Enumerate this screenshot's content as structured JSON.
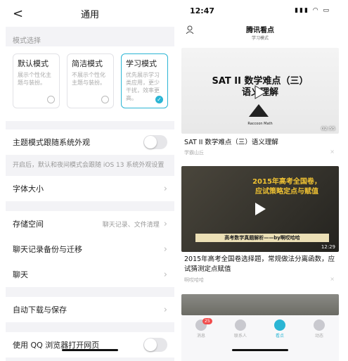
{
  "left": {
    "title": "通用",
    "back": "<",
    "section_label": "模式选择",
    "modes": [
      {
        "name": "默认模式",
        "desc": "展示个性化主题与装扮。",
        "selected": false
      },
      {
        "name": "简洁模式",
        "desc": "不展示个性化主题与装扮。",
        "selected": false
      },
      {
        "name": "学习模式",
        "desc": "优先展示学习类应用，更少干扰，效率更高。",
        "selected": true
      }
    ],
    "theme_follow": {
      "label": "主题模式跟随系统外观",
      "on": false
    },
    "theme_note": "开启后，默认和夜间模式会跟随 iOS 13 系统外观设置",
    "font_size": "字体大小",
    "storage": {
      "label": "存储空间",
      "value": "聊天记录、文件清理"
    },
    "backup": "聊天记录备份与迁移",
    "chat": "聊天",
    "auto_download": "自动下载与保存",
    "qq_browser": {
      "label": "使用 QQ 浏览器打开网页",
      "on": false
    }
  },
  "right": {
    "time": "12:47",
    "status_icons": "▮▮▮ ◠ ▭",
    "header": {
      "logo": "腾讯看点",
      "sub": "学习模式"
    },
    "videos": [
      {
        "title_lines": [
          "SAT II 数学难点（三）",
          "语义理解"
        ],
        "brand": "Raccoon Math",
        "duration": "02:55",
        "caption": "SAT II 数学难点（三）语义理解",
        "source": "学霸山丘"
      },
      {
        "title_lines": [
          "2015年高考全国卷，",
          "应试策略定点与赋值"
        ],
        "banner": "高考数学真题解析——by啊哎哈哈",
        "duration": "12:29",
        "caption": "2015年高考全国卷选择题，常规做法分离函数，应试猜测定点赋值",
        "source": "啊哎哈哈"
      }
    ],
    "tabs": [
      {
        "label": "消息",
        "badge": "25",
        "active": false
      },
      {
        "label": "联系人",
        "badge": "",
        "active": false
      },
      {
        "label": "看点",
        "badge": "",
        "active": true
      },
      {
        "label": "动态",
        "badge": "",
        "active": false
      }
    ],
    "close": "×"
  },
  "colors": {
    "accent": "#2bb5d4",
    "badge": "#f14c4c"
  }
}
